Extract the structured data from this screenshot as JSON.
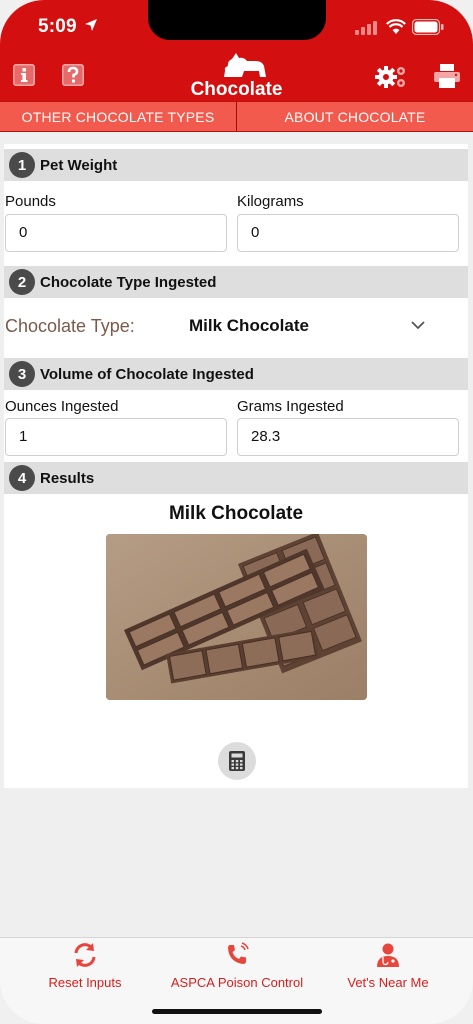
{
  "status_bar": {
    "time": "5:09"
  },
  "header": {
    "title": "Chocolate",
    "icons": [
      "info-icon",
      "help-icon",
      "settings-icon",
      "print-icon",
      "dogs-logo"
    ]
  },
  "tabs": [
    {
      "label": "OTHER CHOCOLATE TYPES"
    },
    {
      "label": "ABOUT CHOCOLATE"
    }
  ],
  "sections": {
    "pet_weight": {
      "number": "1",
      "title": "Pet Weight",
      "pounds_label": "Pounds",
      "pounds_value": "0",
      "kilograms_label": "Kilograms",
      "kilograms_value": "0"
    },
    "chocolate_type": {
      "number": "2",
      "title": "Chocolate Type Ingested",
      "label": "Chocolate Type:",
      "selected": "Milk Chocolate"
    },
    "volume": {
      "number": "3",
      "title": "Volume of Chocolate Ingested",
      "ounces_label": "Ounces Ingested",
      "ounces_value": "1",
      "grams_label": "Grams Ingested",
      "grams_value": "28.3"
    },
    "results": {
      "number": "4",
      "title": "Results",
      "chocolate_name": "Milk Chocolate"
    }
  },
  "bottom_bar": {
    "reset": "Reset Inputs",
    "poison_control": "ASPCA Poison Control",
    "vets": "Vet's Near Me"
  },
  "colors": {
    "brand_red": "#d30f0f",
    "tab_red": "#f15a4d",
    "accent_text": "#d51f1f"
  }
}
